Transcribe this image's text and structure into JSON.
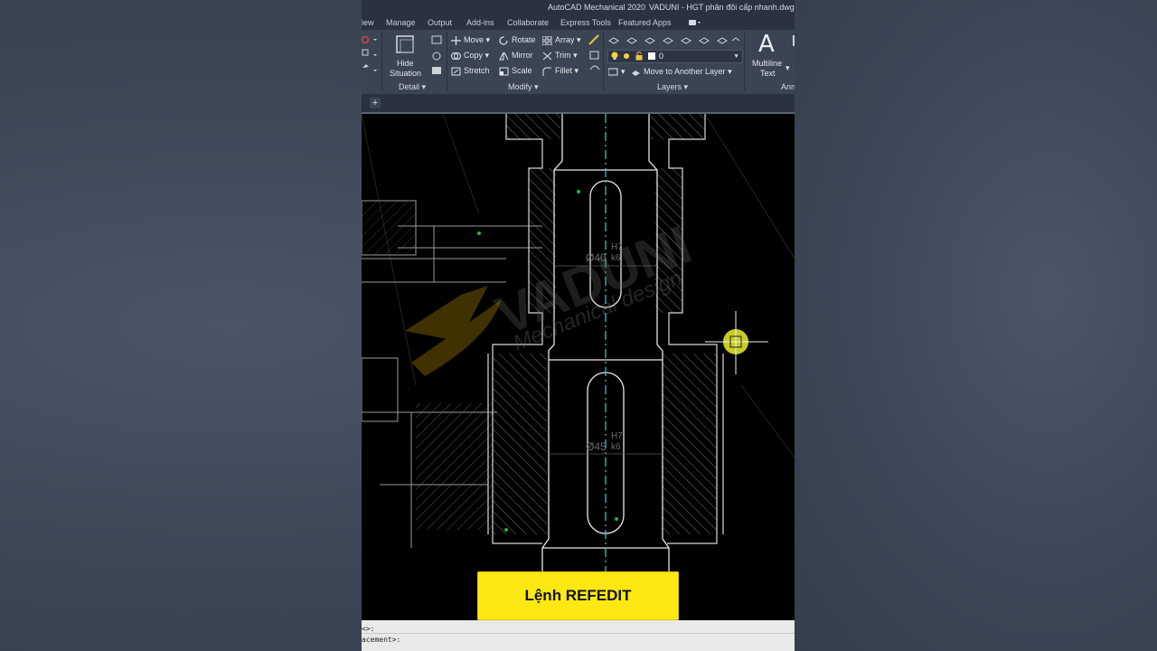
{
  "titlebar": {
    "app_title": "AutoCAD Mechanical 2020",
    "file_title": "VADUNI - HGT phân đôi cấp nhanh.dwg"
  },
  "menu": [
    "iew",
    "Manage",
    "Output",
    "Add-ins",
    "Collaborate",
    "Express Tools",
    "Featured Apps"
  ],
  "ribbon": {
    "detail": {
      "hide_line1": "Hide",
      "hide_line2": "Situation",
      "panel_label": "Detail ▾"
    },
    "modify": {
      "move": "Move",
      "copy": "Copy",
      "stretch": "Stretch",
      "rotate": "Rotate",
      "mirror": "Mirror",
      "scale": "Scale",
      "array": "Array",
      "trim": "Trim",
      "fillet": "Fillet",
      "panel_label": "Modify ▾"
    },
    "layers": {
      "current_layer": "0",
      "move_to_layer": "Move to Another Layer",
      "panel_label": "Layers ▾"
    },
    "annotation": {
      "big_glyph": "A",
      "mtext_line1": "Multiline",
      "mtext_line2": "Text",
      "panel_label_partial": "Ann"
    }
  },
  "tabstrip": {
    "new_tab": "+"
  },
  "drawing": {
    "dim_upper": "Ø40",
    "fit_upper_top": "H7",
    "fit_upper_bottom": "k6",
    "dim_lower": "Ø45",
    "fit_lower_top": "H7",
    "fit_lower_bottom": "k6",
    "watermark_brand": "VADUNI",
    "watermark_sub": "Mechanical design"
  },
  "command_line": {
    "line1": "<>:",
    "line2": "acement>:"
  },
  "caption": "Lệnh REFEDIT",
  "colors": {
    "accent_yellow": "#fde814",
    "ribbon_bg": "#3b4453",
    "canvas_bg": "#000000",
    "centerline": "#3fd0c8"
  }
}
